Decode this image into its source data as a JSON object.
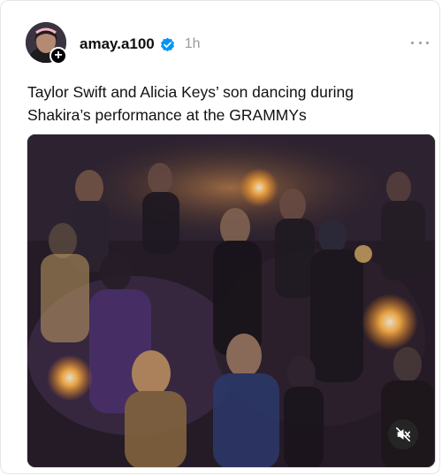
{
  "post": {
    "author": {
      "username": "amay.a100",
      "verified": true,
      "avatar_icon": "avatar-photo",
      "follow_badge": "+"
    },
    "time": "1h",
    "more_icon": "ellipsis-icon",
    "caption": "Taylor Swift and Alicia Keys’ son dancing during Shakira’s performance at the GRAMMYs",
    "media": {
      "type": "video",
      "mute_icon": "speaker-muted-icon"
    }
  },
  "colors": {
    "verified_blue": "#0095f6",
    "text_primary": "#101010",
    "text_secondary": "#9a9a9a"
  }
}
